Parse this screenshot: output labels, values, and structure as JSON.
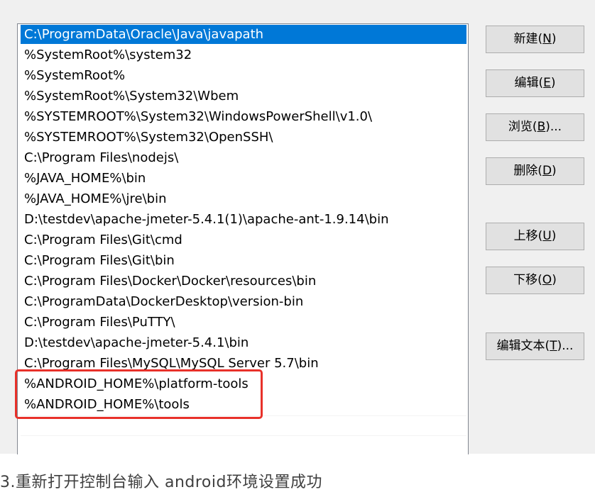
{
  "path_list": {
    "entries": [
      "C:\\ProgramData\\Oracle\\Java\\javapath",
      "%SystemRoot%\\system32",
      "%SystemRoot%",
      "%SystemRoot%\\System32\\Wbem",
      "%SYSTEMROOT%\\System32\\WindowsPowerShell\\v1.0\\",
      "%SYSTEMROOT%\\System32\\OpenSSH\\",
      "C:\\Program Files\\nodejs\\",
      "%JAVA_HOME%\\bin",
      "%JAVA_HOME%\\jre\\bin",
      "D:\\testdev\\apache-jmeter-5.4.1(1)\\apache-ant-1.9.14\\bin",
      "C:\\Program Files\\Git\\cmd",
      "C:\\Program Files\\Git\\bin",
      "C:\\Program Files\\Docker\\Docker\\resources\\bin",
      "C:\\ProgramData\\DockerDesktop\\version-bin",
      "C:\\Program Files\\PuTTY\\",
      "D:\\testdev\\apache-jmeter-5.4.1\\bin",
      "C:\\Program Files\\MySQL\\MySQL Server 5.7\\bin",
      "%ANDROID_HOME%\\platform-tools",
      "%ANDROID_HOME%\\tools"
    ],
    "selected_index": 0,
    "highlighted_entries": [
      17,
      18
    ]
  },
  "buttons": {
    "new": {
      "label": "新建(",
      "key": "N",
      "suffix": ")"
    },
    "edit": {
      "label": "编辑(",
      "key": "E",
      "suffix": ")"
    },
    "browse": {
      "label": "浏览(",
      "key": "B",
      "suffix": ")..."
    },
    "delete": {
      "label": "删除(",
      "key": "D",
      "suffix": ")"
    },
    "move_up": {
      "label": "上移(",
      "key": "U",
      "suffix": ")"
    },
    "move_down": {
      "label": "下移(",
      "key": "O",
      "suffix": ")"
    },
    "edit_text": {
      "label": "编辑文本(",
      "key": "T",
      "suffix": ")..."
    }
  },
  "caption": "3.重新打开控制台输入   android环境设置成功",
  "colors": {
    "selection": "#0078d7",
    "highlight_border": "#e8312a",
    "dialog_bg": "#f0f0f0"
  }
}
